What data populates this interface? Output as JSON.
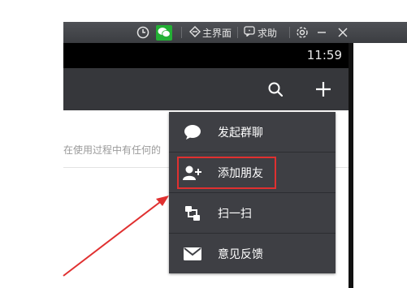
{
  "titlebar": {
    "main_label": "主界面",
    "help_label": "求助",
    "colors": {
      "wechat": "#23b035"
    },
    "icons": [
      "clock-icon",
      "wechat-icon",
      "settings-icon",
      "minimize-icon",
      "close-icon"
    ]
  },
  "statusbar": {
    "time": "11:59"
  },
  "content": {
    "notice": "在使用过程中有任何的"
  },
  "menu": {
    "items": [
      {
        "label": "发起群聊",
        "icon": "chat-bubble-icon"
      },
      {
        "label": "添加朋友",
        "icon": "add-friend-icon"
      },
      {
        "label": "扫一扫",
        "icon": "scan-icon"
      },
      {
        "label": "意见反馈",
        "icon": "mail-icon"
      }
    ]
  },
  "annotation": {
    "highlight_color": "#e03030"
  }
}
